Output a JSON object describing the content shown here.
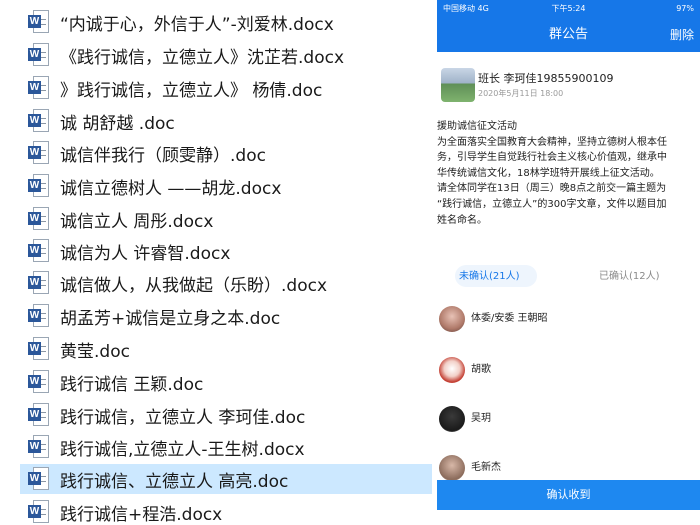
{
  "file_list": {
    "files": [
      {
        "name": "“内诚于心，外信于人”-刘爱林.docx",
        "icon": "word-document-icon"
      },
      {
        "name": "《践行诚信，立德立人》沈芷若.docx",
        "icon": "word-document-icon"
      },
      {
        "name": "》践行诚信，立德立人》 杨倩.doc",
        "icon": "word-document-icon"
      },
      {
        "name": "诚 胡舒越 .doc",
        "icon": "word-document-icon"
      },
      {
        "name": "诚信伴我行（顾雯静）.doc",
        "icon": "word-document-icon"
      },
      {
        "name": "诚信立德树人 ——胡龙.docx",
        "icon": "word-document-icon"
      },
      {
        "name": "诚信立人 周彤.docx",
        "icon": "word-document-icon"
      },
      {
        "name": "诚信为人 许睿智.docx",
        "icon": "word-document-icon"
      },
      {
        "name": "诚信做人，从我做起（乐盼）.docx",
        "icon": "word-document-icon"
      },
      {
        "name": "胡孟芳+诚信是立身之本.doc",
        "icon": "word-document-icon"
      },
      {
        "name": "黄莹.doc",
        "icon": "word-document-icon"
      },
      {
        "name": "践行诚信 王颖.doc",
        "icon": "word-document-icon"
      },
      {
        "name": "践行诚信，立德立人 李珂佳.doc",
        "icon": "word-document-icon"
      },
      {
        "name": "践行诚信,立德立人-王生树.docx",
        "icon": "word-document-icon"
      },
      {
        "name": "践行诚信、立德立人 高亮.doc",
        "icon": "word-document-icon"
      },
      {
        "name": "践行诚信+程浩.docx",
        "icon": "word-document-icon"
      }
    ],
    "selected_index": 14,
    "icon_badge": "W",
    "selection_color": "#cce8ff"
  },
  "phone": {
    "status_bar": {
      "carrier": "中国移动 4G",
      "time": "下午5:24",
      "battery": "97%"
    },
    "nav": {
      "title": "群公告",
      "action": "删除"
    },
    "post": {
      "author": "班长 李珂佳19855900109",
      "date": "2020年5月11日 18:00",
      "body_lines": [
        "援助诚信征文活动",
        "为全面落实全国教育大会精神，坚持立德树人根本任",
        "务，引导学生自觉践行社会主义核心价值观，继承中",
        "华传统诚信文化，18林学班特开展线上征文活动。",
        "请全体同学在13日（周三）晚8点之前交一篇主题为",
        "“践行诚信，立德立人”的300字文章，文件以题目加",
        "姓名命名。"
      ]
    },
    "tabs": {
      "unconfirmed": "未确认(21人)",
      "confirmed": "已确认(12人)"
    },
    "members": [
      {
        "name": "体委/安委 王朝昭"
      },
      {
        "name": "胡歌"
      },
      {
        "name": "吴玥"
      },
      {
        "name": "毛新杰"
      }
    ],
    "confirm_button": "确认收到",
    "accent_color": "#1677e8"
  }
}
